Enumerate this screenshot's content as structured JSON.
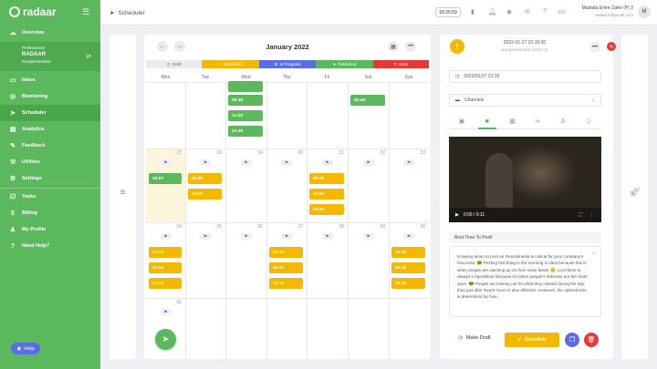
{
  "app": {
    "logo": "radaar"
  },
  "sidebar": {
    "items_top": [
      {
        "label": "Overview",
        "icon": "dashboard-icon"
      }
    ],
    "org": {
      "label": "Professional",
      "name": "RADAAR",
      "sub": "Europe/Istanbul"
    },
    "items": [
      {
        "label": "Inbox",
        "icon": "inbox-icon"
      },
      {
        "label": "Monitoring",
        "icon": "monitoring-icon"
      },
      {
        "label": "Scheduler",
        "icon": "send-icon"
      },
      {
        "label": "Analytics",
        "icon": "analytics-icon"
      },
      {
        "label": "Feedback",
        "icon": "feedback-icon"
      },
      {
        "label": "Utilities",
        "icon": "utilities-icon"
      },
      {
        "label": "Settings",
        "icon": "settings-icon"
      },
      {
        "label": "Tasks",
        "icon": "tasks-icon"
      },
      {
        "label": "Billing",
        "icon": "billing-icon"
      },
      {
        "label": "My Profile",
        "icon": "profile-icon"
      },
      {
        "label": "Need Help?",
        "icon": "help-icon"
      }
    ],
    "help_button": "Help"
  },
  "topbar": {
    "breadcrumb": "Scheduler",
    "clock": "18:25:59",
    "lang": "EN",
    "user_name": "Mustafa Emre Zafer (P) 2",
    "user_email": "radaar.tr@gmail.com",
    "avatar": "M"
  },
  "calendar": {
    "month": "January 2022",
    "legend": [
      {
        "label": "Draft",
        "color": "#e9ebef",
        "text": "#666"
      },
      {
        "label": "Scheduled",
        "color": "#f5b800",
        "text": "#fff"
      },
      {
        "label": "In Progress",
        "color": "#5b6ee1",
        "text": "#fff"
      },
      {
        "label": "Published",
        "color": "#5cb85c",
        "text": "#fff"
      },
      {
        "label": "Error",
        "color": "#e53935",
        "text": "#fff"
      }
    ],
    "days": [
      "Mon",
      "Tue",
      "Wed",
      "Thu",
      "Fri",
      "Sat",
      "Sun"
    ],
    "week1_events": [
      {
        "day": 2,
        "time": "",
        "color": "green",
        "slot": 0
      },
      {
        "day": 2,
        "time": "09:30",
        "color": "green",
        "slot": 1
      },
      {
        "day": 2,
        "time": "13:00",
        "color": "green",
        "slot": 2
      },
      {
        "day": 2,
        "time": "22:30",
        "color": "green",
        "slot": 3
      },
      {
        "day": 5,
        "time": "20:45",
        "color": "green",
        "slot": 1
      }
    ],
    "week2_numbers": [
      "17",
      "18",
      "19",
      "20",
      "21",
      "22",
      "23"
    ],
    "week2_events": [
      {
        "day": 0,
        "time": "10:57",
        "color": "green",
        "slot": 0
      },
      {
        "day": 1,
        "time": "20:00",
        "color": "yellow",
        "slot": 0
      },
      {
        "day": 1,
        "time": "23:00",
        "color": "yellow",
        "slot": 1
      },
      {
        "day": 4,
        "time": "20:00",
        "color": "yellow",
        "slot": 0
      },
      {
        "day": 4,
        "time": "23:00",
        "color": "yellow",
        "slot": 1
      },
      {
        "day": 4,
        "time": "21:00",
        "color": "yellow",
        "slot": 2
      }
    ],
    "week3_numbers": [
      "24",
      "25",
      "26",
      "27",
      "28",
      "29",
      "30"
    ],
    "week3_events": [
      {
        "day": 0,
        "time": "21:15",
        "color": "yellow",
        "slot": 0
      },
      {
        "day": 0,
        "time": "21:15",
        "color": "yellow",
        "slot": 1
      },
      {
        "day": 0,
        "time": "21:15",
        "color": "yellow",
        "slot": 2
      },
      {
        "day": 3,
        "time": "22:15",
        "color": "yellow",
        "slot": 0
      },
      {
        "day": 3,
        "time": "22:15",
        "color": "yellow",
        "slot": 1
      },
      {
        "day": 3,
        "time": "22:15",
        "color": "yellow",
        "slot": 2
      },
      {
        "day": 6,
        "time": "20:45",
        "color": "yellow",
        "slot": 0
      },
      {
        "day": 6,
        "time": "20:45",
        "color": "yellow",
        "slot": 1
      },
      {
        "day": 6,
        "time": "20:45",
        "color": "yellow",
        "slot": 2
      }
    ],
    "week4_numbers": [
      "31"
    ]
  },
  "post": {
    "date_title": "2022-01-27 22:15:00",
    "date_sub": "Europe/Istanbul (GMT+3)",
    "datetime_field": "2022/01/27 22:15",
    "channels_placeholder": "Channels",
    "video_time": "0:00 / 0:11",
    "caption_title": "Best Time To Post!",
    "caption": "Knowing when to post on #socialmedia is critical for your company's #success. 🤓 Posting first thing in the morning is ideal because this is when people are catching up on their news feeds. 😊 Lunchtime is always a #goodtime because it's when people's #phones are the most open. 😎 People are looking out for what they missed during the day, thus just after #work hours is also effective. However, the optimal time is determined by how...",
    "draft_label": "Make Draft",
    "schedule_label": "Schedule"
  }
}
